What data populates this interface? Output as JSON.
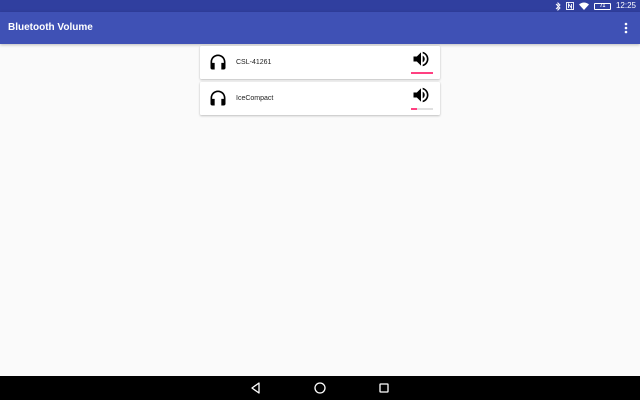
{
  "status_bar": {
    "icons": [
      "bluetooth-icon",
      "nfc-icon",
      "wifi-icon",
      "battery-icon"
    ],
    "battery_level": "71",
    "time": "12:25"
  },
  "app_bar": {
    "title": "Bluetooth Volume",
    "menu_icon": "overflow-menu-icon"
  },
  "devices": [
    {
      "name": "CSL-41261",
      "icon": "headphones-icon",
      "volume_icon": "volume-up-icon",
      "volume_fraction": 1.0
    },
    {
      "name": "IceCompact",
      "icon": "headphones-icon",
      "volume_icon": "volume-up-icon",
      "volume_fraction": 0.27
    }
  ],
  "nav_bar": {
    "buttons": [
      "back-icon",
      "home-icon",
      "recents-icon"
    ]
  },
  "colors": {
    "primary": "#3f51b5",
    "primary_dark": "#303f9f",
    "accent": "#ff4081",
    "background": "#fafafa"
  }
}
